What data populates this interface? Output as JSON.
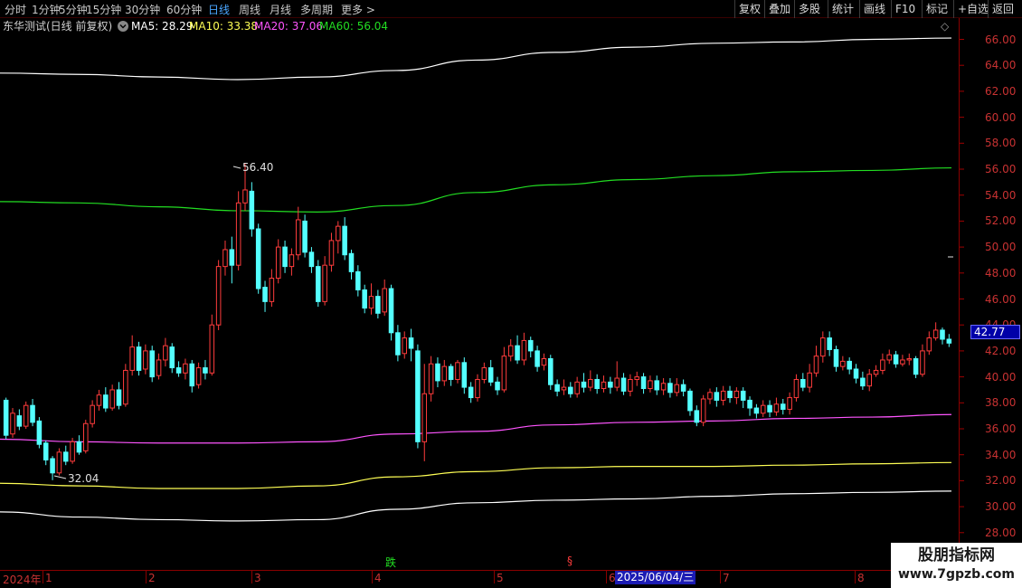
{
  "toolbar": {
    "periods": [
      "分时",
      "1分钟",
      "5分钟",
      "15分钟",
      "30分钟",
      "60分钟",
      "日线",
      "周线",
      "月线",
      "多周期",
      "更多"
    ],
    "more_arrow": ">",
    "actions": [
      "复权",
      "叠加",
      "多股",
      "统计",
      "画线",
      "F10",
      "标记",
      "+自选",
      "返回"
    ],
    "active_period": "日线"
  },
  "title": {
    "stock": "东华测试(日线 前复权)",
    "toggle_icon": "chevron-circle-icon",
    "ma5": "MA5: 28.29",
    "ma10": "MA10: 33.38",
    "ma20": "MA20: 37.06",
    "ma60": "MA60: 56.04",
    "diamond": "◇"
  },
  "colors": {
    "up": "#ff3c3c",
    "down": "#54ffff",
    "ma5": "#ffffff",
    "ma10": "#ffff55",
    "ma20": "#ff55ff",
    "ma60": "#22dd22",
    "axis_text": "#c83232",
    "active": "#4aa6ff"
  },
  "axis": {
    "ticks": [
      "66.00",
      "64.00",
      "62.00",
      "60.00",
      "58.00",
      "56.00",
      "54.00",
      "52.00",
      "50.00",
      "48.00",
      "46.00",
      "44.00",
      "42.00",
      "40.00",
      "38.00",
      "36.00",
      "34.00",
      "32.00",
      "30.00",
      "28.00"
    ],
    "current_price": "42.77"
  },
  "annotations": {
    "high": "56.40",
    "low": "32.04",
    "signal_down": "跌",
    "signal_s": "§"
  },
  "dateaxis": {
    "year": "2024年",
    "months": [
      "1",
      "2",
      "3",
      "4",
      "5",
      "6",
      "7",
      "8"
    ],
    "cursor_date": "2025/06/04/三"
  },
  "watermark": {
    "line1": "股朋指标网",
    "line2": "www.7gpzb.com"
  },
  "chart_data": {
    "type": "candlestick",
    "ylim": [
      26.2,
      67.2
    ],
    "ma_levels": {
      "white_upper": [
        63.4,
        63.3,
        63.1,
        62.9,
        63.1,
        63.6,
        64.4,
        65.0,
        65.4,
        65.7,
        65.8,
        66.0,
        66.1
      ],
      "green": [
        53.5,
        53.4,
        53.1,
        52.8,
        52.7,
        53.2,
        54.2,
        54.8,
        55.2,
        55.5,
        55.8,
        55.9,
        56.1
      ],
      "magenta": [
        35.2,
        35.0,
        34.9,
        34.9,
        35.0,
        35.6,
        35.8,
        36.3,
        36.5,
        36.6,
        36.8,
        36.9,
        37.1
      ],
      "yellow": [
        31.8,
        31.6,
        31.4,
        31.4,
        31.6,
        32.3,
        32.7,
        33.0,
        33.1,
        33.1,
        33.2,
        33.3,
        33.4
      ],
      "white_lower": [
        29.6,
        29.2,
        29.0,
        28.9,
        29.0,
        29.8,
        30.3,
        30.5,
        30.6,
        30.8,
        31.0,
        31.1,
        31.2
      ]
    },
    "candles": [
      [
        38.2,
        35.5,
        38.4,
        35.2
      ],
      [
        35.6,
        37.2,
        37.6,
        35.3
      ],
      [
        37.0,
        36.2,
        37.5,
        35.9
      ],
      [
        36.2,
        37.8,
        38.1,
        36.0
      ],
      [
        37.8,
        36.5,
        38.3,
        36.2
      ],
      [
        36.6,
        34.8,
        36.9,
        34.5
      ],
      [
        34.9,
        33.6,
        35.1,
        33.2
      ],
      [
        33.7,
        32.6,
        33.9,
        32.04
      ],
      [
        32.6,
        34.2,
        34.5,
        32.4
      ],
      [
        34.2,
        33.5,
        34.7,
        33.2
      ],
      [
        33.5,
        35.0,
        35.3,
        33.3
      ],
      [
        35.0,
        34.2,
        35.5,
        34.0
      ],
      [
        34.3,
        36.4,
        36.7,
        34.1
      ],
      [
        36.4,
        37.8,
        38.2,
        36.1
      ],
      [
        37.8,
        38.6,
        39.0,
        37.4
      ],
      [
        38.6,
        37.6,
        39.2,
        37.3
      ],
      [
        37.6,
        39.0,
        39.4,
        37.4
      ],
      [
        39.0,
        37.8,
        39.6,
        37.5
      ],
      [
        37.9,
        40.5,
        41.0,
        37.7
      ],
      [
        40.5,
        42.3,
        43.2,
        40.1
      ],
      [
        42.3,
        40.5,
        42.7,
        40.1
      ],
      [
        40.6,
        42.0,
        42.5,
        40.2
      ],
      [
        42.0,
        40.0,
        42.4,
        39.6
      ],
      [
        40.1,
        41.3,
        41.8,
        39.8
      ],
      [
        41.3,
        42.4,
        43.0,
        40.8
      ],
      [
        42.3,
        40.7,
        42.6,
        40.3
      ],
      [
        40.7,
        40.3,
        41.2,
        40.0
      ],
      [
        40.3,
        41.0,
        41.4,
        39.8
      ],
      [
        41.0,
        39.3,
        41.3,
        38.8
      ],
      [
        39.4,
        40.7,
        41.1,
        39.1
      ],
      [
        40.7,
        40.3,
        41.3,
        39.8
      ],
      [
        40.3,
        44.0,
        44.8,
        40.1
      ],
      [
        44.0,
        48.5,
        49.0,
        43.6
      ],
      [
        48.5,
        49.8,
        50.5,
        47.8
      ],
      [
        49.8,
        48.6,
        50.8,
        47.2
      ],
      [
        48.6,
        53.4,
        54.3,
        48.2
      ],
      [
        53.4,
        54.4,
        56.4,
        52.8
      ],
      [
        54.3,
        51.4,
        55.0,
        50.8
      ],
      [
        51.4,
        46.8,
        51.8,
        46.4
      ],
      [
        46.9,
        45.8,
        47.4,
        45.0
      ],
      [
        45.8,
        47.6,
        48.3,
        45.4
      ],
      [
        47.6,
        50.0,
        50.6,
        47.2
      ],
      [
        50.0,
        48.5,
        50.5,
        48.0
      ],
      [
        48.5,
        49.4,
        49.9,
        47.8
      ],
      [
        49.4,
        52.1,
        53.1,
        49.0
      ],
      [
        52.0,
        49.6,
        52.5,
        49.2
      ],
      [
        49.6,
        48.5,
        50.0,
        48.0
      ],
      [
        48.5,
        45.8,
        49.0,
        45.4
      ],
      [
        45.8,
        48.6,
        49.3,
        45.5
      ],
      [
        48.6,
        50.5,
        51.1,
        48.1
      ],
      [
        50.5,
        51.6,
        52.0,
        49.5
      ],
      [
        51.6,
        49.4,
        52.3,
        49.0
      ],
      [
        49.5,
        48.1,
        49.8,
        47.5
      ],
      [
        48.1,
        46.7,
        48.6,
        46.2
      ],
      [
        46.7,
        45.3,
        47.1,
        44.9
      ],
      [
        45.3,
        46.2,
        47.2,
        44.8
      ],
      [
        46.2,
        44.9,
        46.7,
        44.5
      ],
      [
        45.0,
        46.8,
        47.5,
        44.7
      ],
      [
        46.8,
        43.4,
        47.1,
        42.8
      ],
      [
        43.4,
        41.7,
        44.0,
        41.2
      ],
      [
        41.8,
        43.0,
        43.5,
        41.4
      ],
      [
        43.0,
        42.2,
        43.7,
        41.2
      ],
      [
        42.0,
        35.0,
        42.5,
        34.5
      ],
      [
        35.0,
        38.7,
        41.0,
        33.5
      ],
      [
        38.7,
        41.0,
        41.6,
        38.1
      ],
      [
        41.0,
        39.7,
        41.5,
        39.2
      ],
      [
        39.7,
        40.8,
        41.3,
        39.3
      ],
      [
        40.8,
        39.8,
        41.0,
        39.3
      ],
      [
        39.8,
        41.1,
        41.3,
        39.5
      ],
      [
        41.1,
        39.2,
        41.5,
        38.7
      ],
      [
        39.2,
        38.4,
        39.6,
        38.0
      ],
      [
        38.4,
        39.8,
        40.2,
        38.1
      ],
      [
        39.8,
        40.7,
        41.1,
        39.5
      ],
      [
        40.7,
        39.6,
        41.3,
        39.3
      ],
      [
        39.6,
        39.0,
        40.0,
        38.6
      ],
      [
        39.0,
        41.6,
        42.3,
        38.8
      ],
      [
        41.6,
        42.4,
        42.9,
        41.2
      ],
      [
        42.4,
        41.3,
        43.2,
        41.0
      ],
      [
        41.3,
        42.8,
        43.4,
        40.9
      ],
      [
        42.8,
        42.0,
        43.1,
        41.5
      ],
      [
        42.0,
        40.8,
        42.4,
        40.4
      ],
      [
        40.9,
        41.4,
        41.8,
        40.5
      ],
      [
        41.4,
        39.4,
        41.7,
        39.0
      ],
      [
        39.4,
        38.9,
        39.8,
        38.5
      ],
      [
        39.0,
        39.2,
        39.8,
        38.6
      ],
      [
        39.2,
        38.7,
        39.6,
        38.4
      ],
      [
        38.7,
        39.6,
        40.0,
        38.4
      ],
      [
        39.6,
        39.2,
        40.3,
        38.8
      ],
      [
        39.2,
        39.8,
        40.5,
        38.9
      ],
      [
        39.8,
        39.1,
        40.2,
        38.7
      ],
      [
        39.1,
        39.6,
        40.1,
        38.8
      ],
      [
        39.6,
        39.2,
        40.0,
        38.7
      ],
      [
        39.2,
        39.9,
        41.2,
        38.9
      ],
      [
        39.9,
        38.9,
        40.3,
        38.6
      ],
      [
        38.9,
        39.8,
        40.2,
        38.5
      ],
      [
        39.8,
        40.0,
        40.4,
        39.3
      ],
      [
        40.0,
        39.1,
        40.3,
        38.7
      ],
      [
        39.1,
        39.7,
        40.1,
        38.8
      ],
      [
        39.7,
        39.0,
        40.1,
        38.6
      ],
      [
        39.0,
        39.5,
        39.9,
        38.6
      ],
      [
        39.5,
        38.8,
        39.9,
        38.4
      ],
      [
        38.8,
        39.4,
        39.9,
        38.5
      ],
      [
        39.4,
        38.9,
        39.8,
        38.5
      ],
      [
        38.9,
        37.4,
        39.1,
        37.0
      ],
      [
        37.4,
        36.5,
        37.8,
        36.2
      ],
      [
        36.5,
        38.3,
        38.6,
        36.2
      ],
      [
        38.3,
        38.8,
        39.1,
        37.9
      ],
      [
        38.8,
        38.2,
        39.2,
        37.7
      ],
      [
        38.2,
        38.9,
        39.3,
        37.8
      ],
      [
        38.9,
        38.4,
        39.3,
        38.0
      ],
      [
        38.4,
        38.9,
        39.2,
        37.9
      ],
      [
        38.9,
        38.2,
        39.2,
        37.6
      ],
      [
        38.2,
        37.6,
        38.5,
        37.0
      ],
      [
        37.6,
        37.2,
        37.9,
        36.8
      ],
      [
        37.2,
        37.8,
        38.2,
        36.9
      ],
      [
        37.8,
        37.3,
        38.2,
        36.9
      ],
      [
        37.3,
        37.9,
        38.4,
        37.0
      ],
      [
        37.9,
        37.5,
        38.3,
        37.1
      ],
      [
        37.5,
        38.4,
        38.8,
        37.1
      ],
      [
        38.4,
        39.8,
        40.2,
        38.1
      ],
      [
        39.8,
        39.2,
        40.3,
        38.9
      ],
      [
        39.2,
        40.3,
        41.0,
        38.8
      ],
      [
        40.3,
        41.6,
        42.4,
        40.0
      ],
      [
        41.6,
        43.0,
        43.5,
        41.1
      ],
      [
        43.0,
        42.1,
        43.5,
        41.6
      ],
      [
        42.1,
        40.8,
        42.4,
        40.4
      ],
      [
        40.8,
        41.2,
        41.6,
        40.5
      ],
      [
        41.2,
        40.6,
        41.5,
        40.2
      ],
      [
        40.6,
        39.9,
        41.0,
        39.5
      ],
      [
        39.9,
        39.3,
        40.4,
        39.0
      ],
      [
        39.3,
        40.2,
        40.6,
        38.9
      ],
      [
        40.2,
        40.5,
        40.9,
        40.0
      ],
      [
        40.5,
        41.3,
        41.8,
        40.2
      ],
      [
        41.3,
        41.7,
        42.1,
        41.0
      ],
      [
        41.7,
        41.0,
        42.0,
        40.7
      ],
      [
        41.0,
        41.3,
        41.7,
        40.8
      ],
      [
        41.3,
        41.4,
        41.8,
        40.9
      ],
      [
        41.4,
        40.2,
        41.6,
        39.9
      ],
      [
        40.2,
        42.0,
        42.5,
        40.0
      ],
      [
        42.0,
        43.0,
        43.5,
        41.7
      ],
      [
        43.0,
        43.6,
        44.2,
        42.8
      ],
      [
        43.6,
        42.9,
        43.8,
        42.5
      ],
      [
        42.9,
        42.6,
        43.3,
        42.3
      ]
    ]
  }
}
